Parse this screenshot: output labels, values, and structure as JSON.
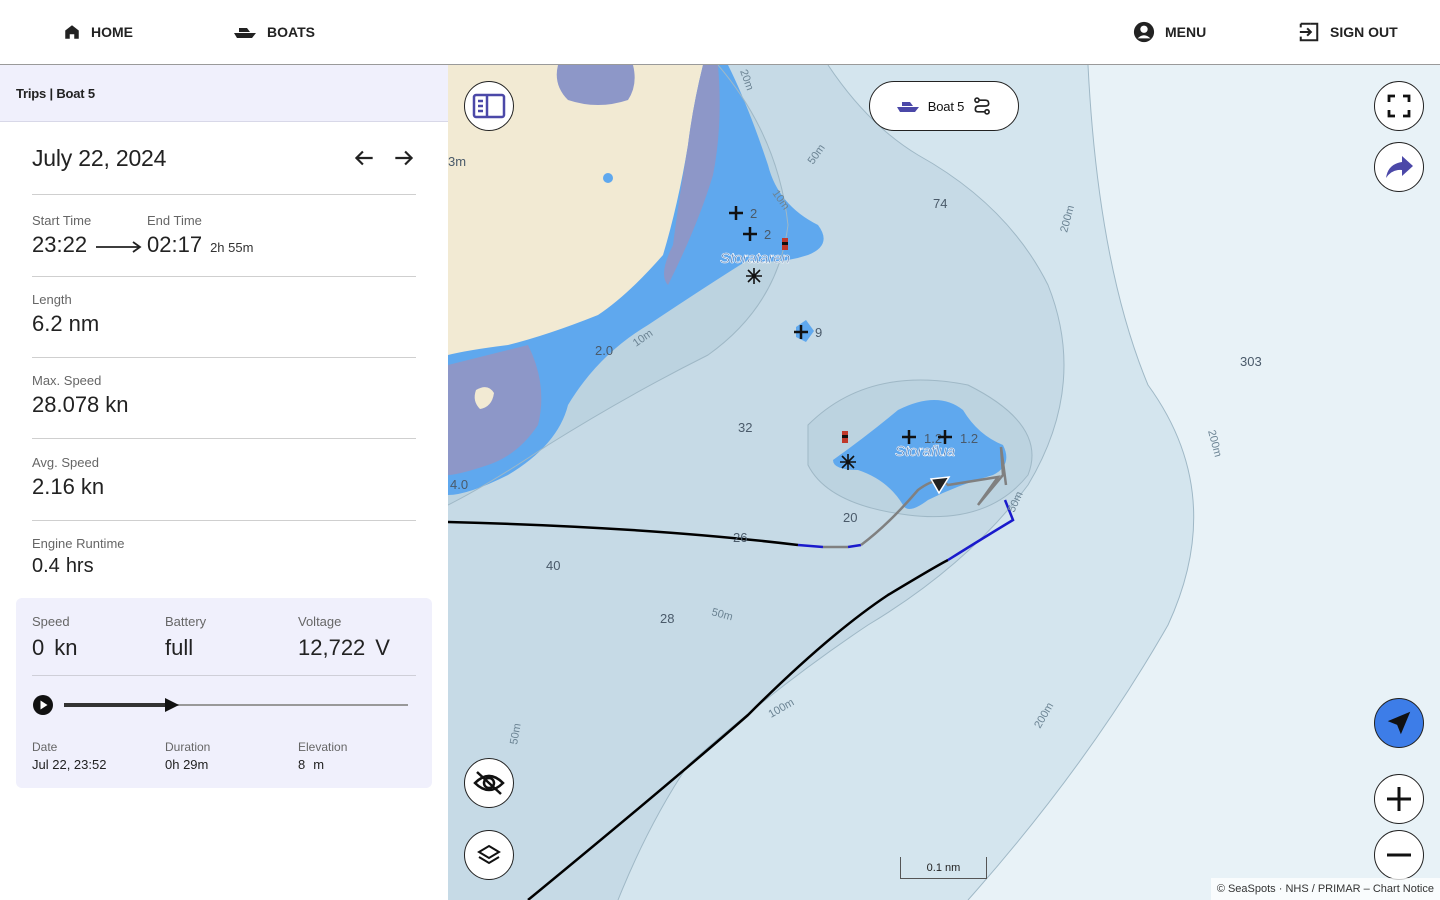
{
  "nav": {
    "home": "HOME",
    "boats": "BOATS",
    "menu": "MENU",
    "sign_out": "SIGN OUT"
  },
  "sidebar": {
    "breadcrumb": "Trips | Boat 5",
    "date": "July 22, 2024",
    "start_time_label": "Start Time",
    "start_time": "23:22",
    "end_time_label": "End Time",
    "end_time": "02:17",
    "duration": "2h 55m",
    "length_label": "Length",
    "length_value": "6.2",
    "length_unit": "nm",
    "max_speed_label": "Max. Speed",
    "max_speed_value": "28.078",
    "max_speed_unit": "kn",
    "avg_speed_label": "Avg. Speed",
    "avg_speed_value": "2.16",
    "avg_speed_unit": "kn",
    "engine_label": "Engine Runtime",
    "engine_value": "0.4",
    "engine_unit": "hrs"
  },
  "live": {
    "speed_label": "Speed",
    "speed_value": "0",
    "speed_unit": "kn",
    "battery_label": "Battery",
    "battery_value": "full",
    "voltage_label": "Voltage",
    "voltage_value": "12,722",
    "voltage_unit": "V",
    "playback_progress": 0.3,
    "date_label": "Date",
    "date_value": "Jul 22, 23:52",
    "duration_label": "Duration",
    "duration_value": "0h 29m",
    "elevation_label": "Elevation",
    "elevation_value": "8",
    "elevation_unit": "m"
  },
  "map": {
    "boat_selector": "Boat 5",
    "scale": "0.1 nm",
    "attribution": "© SeaSpots · NHS / PRIMAR – Chart Notice",
    "place_names": [
      "Storataren",
      "Storaflua"
    ],
    "depth_soundings": [
      "74",
      "303",
      "32",
      "20",
      "26",
      "40",
      "28",
      "2.0",
      "4.0",
      "9",
      "2",
      "1.2",
      "3m"
    ],
    "contour_labels": [
      "20m",
      "50m",
      "10m",
      "10m",
      "200m",
      "200m",
      "200m",
      "50m",
      "100m",
      "50m",
      "50m"
    ],
    "colors": {
      "land": "#f2ead3",
      "shallow": "#5fa8ee",
      "mid_water": "#c8dde8",
      "deep_water": "#e6f1f6",
      "track": "#000000",
      "track_gray": "#808080",
      "track_blue": "#1a1acc",
      "accent": "#3d7de8"
    }
  }
}
